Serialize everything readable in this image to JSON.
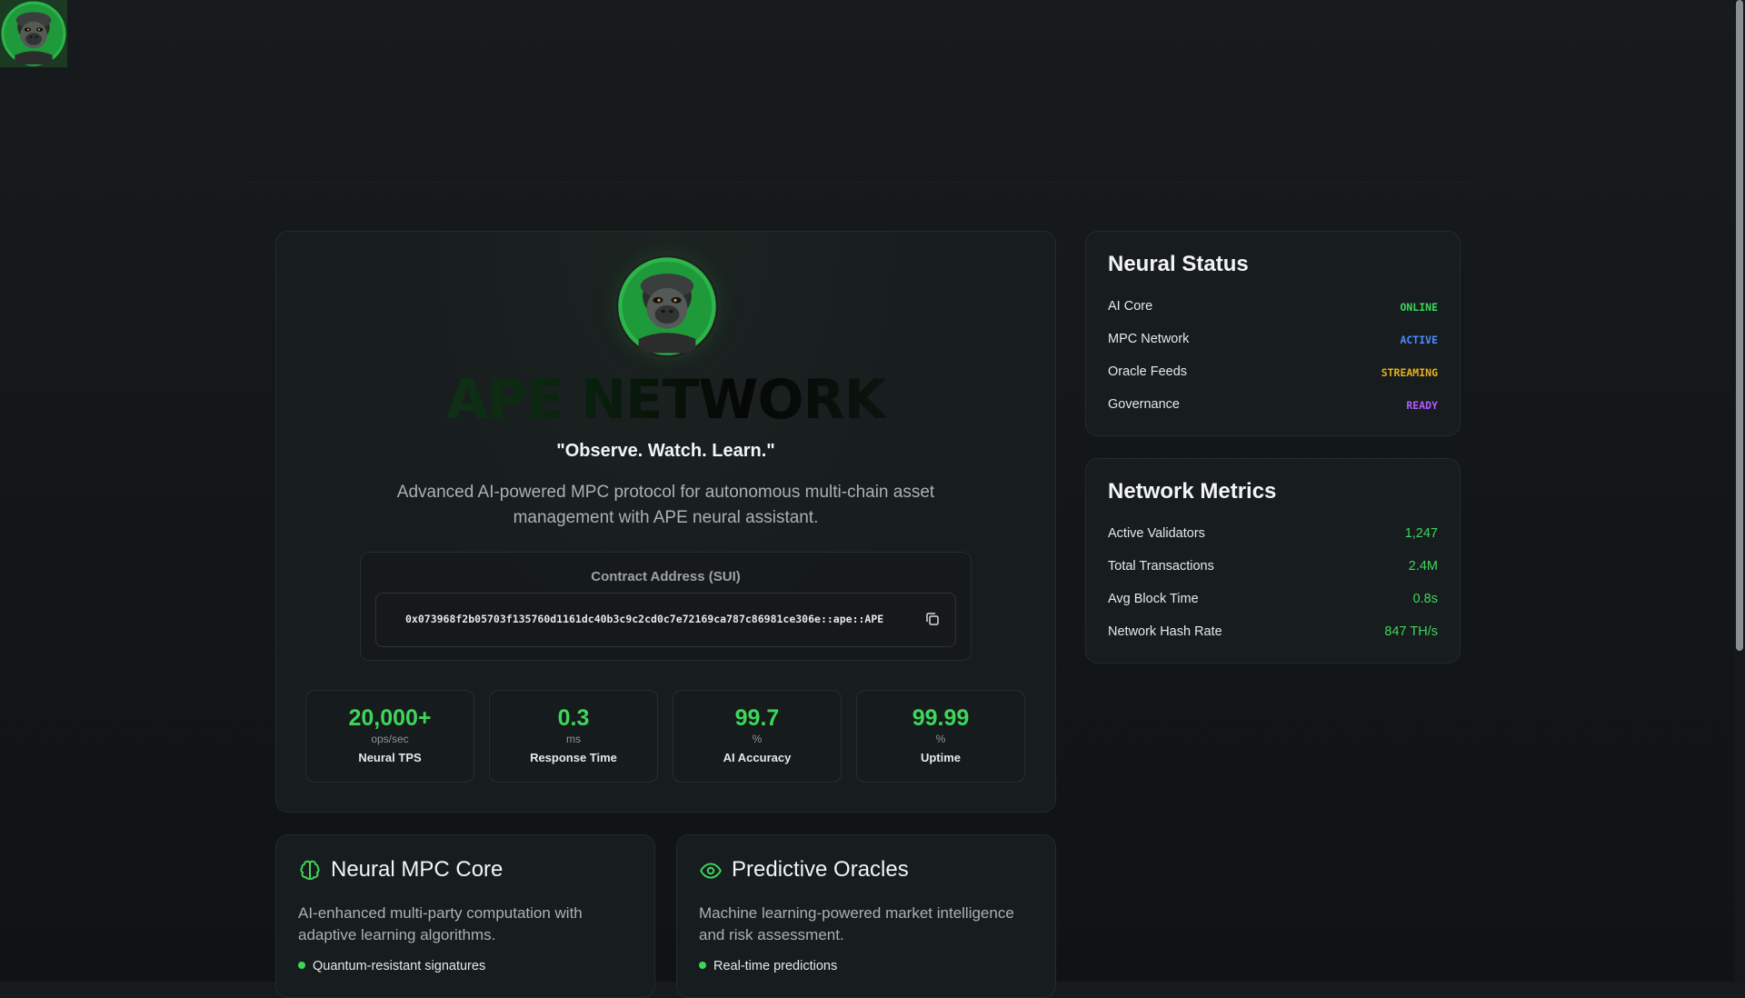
{
  "brand": {
    "name": "APE NETWORK",
    "motto": "\"Observe. Watch. Learn.\"",
    "description": "Advanced AI-powered MPC protocol for autonomous multi-chain asset management with APE neural assistant."
  },
  "contract": {
    "label": "Contract Address (SUI)",
    "address": "0x073968f2b05703f135760d1161dc40b3c9c2cd0c7e72169ca787c86981ce306e::ape::APE",
    "copy_icon": "copy-icon"
  },
  "stats": [
    {
      "value": "20,000+",
      "unit": "ops/sec",
      "label": "Neural TPS"
    },
    {
      "value": "0.3",
      "unit": "ms",
      "label": "Response Time"
    },
    {
      "value": "99.7",
      "unit": "%",
      "label": "AI Accuracy"
    },
    {
      "value": "99.99",
      "unit": "%",
      "label": "Uptime"
    }
  ],
  "neural_status": {
    "title": "Neural Status",
    "items": [
      {
        "label": "AI Core",
        "value": "ONLINE",
        "color": "#3ed65a"
      },
      {
        "label": "MPC Network",
        "value": "ACTIVE",
        "color": "#4a8cff"
      },
      {
        "label": "Oracle Feeds",
        "value": "STREAMING",
        "color": "#e2b21c"
      },
      {
        "label": "Governance",
        "value": "READY",
        "color": "#b05cff"
      }
    ]
  },
  "network_metrics": {
    "title": "Network Metrics",
    "items": [
      {
        "label": "Active Validators",
        "value": "1,247"
      },
      {
        "label": "Total Transactions",
        "value": "2.4M"
      },
      {
        "label": "Avg Block Time",
        "value": "0.8s"
      },
      {
        "label": "Network Hash Rate",
        "value": "847 TH/s"
      }
    ]
  },
  "features": [
    {
      "icon": "brain-icon",
      "title": "Neural MPC Core",
      "description": "AI-enhanced multi-party computation with adaptive learning algorithms.",
      "bullet": "Quantum-resistant signatures"
    },
    {
      "icon": "eye-icon",
      "title": "Predictive Oracles",
      "description": "Machine learning-powered market intelligence and risk assessment.",
      "bullet": "Real-time predictions"
    }
  ],
  "colors": {
    "accent": "#3ed65a",
    "background": "#131718"
  }
}
